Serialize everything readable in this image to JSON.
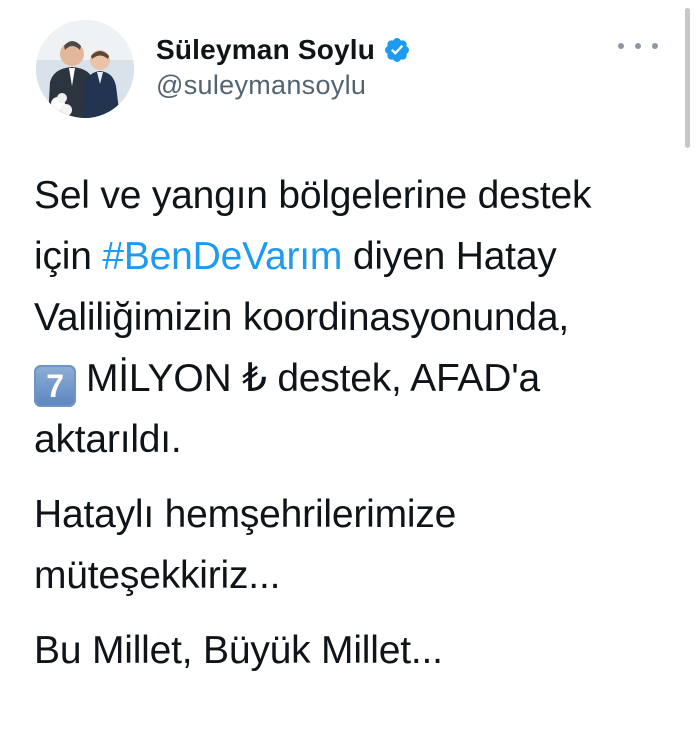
{
  "user": {
    "display_name": "Süleyman Soylu",
    "handle": "@suleymansoylu",
    "verified_icon": "verified-badge-icon",
    "avatar_icon": "profile-photo"
  },
  "menu": {
    "icon": "more-options-icon"
  },
  "tweet": {
    "line1": "Sel ve yangın bölgelerine destek",
    "line2_prefix": "için ",
    "hashtag": "#BenDeVarım",
    "line2_suffix": " diyen Hatay",
    "line3": "Valiliğimizin koordinasyonunda,",
    "keycap": "7",
    "line4_rest": "MİLYON ₺ destek, AFAD'a",
    "line5": "aktarıldı.",
    "para2_line1": "Hataylı hemşehrilerimize",
    "para2_line2": "müteşekkiriz...",
    "para3": "Bu Millet, Büyük Millet..."
  },
  "colors": {
    "hashtag": "#1d9bf0",
    "verified": "#1d9bf0",
    "handle": "#536471",
    "text": "#0f1419"
  }
}
